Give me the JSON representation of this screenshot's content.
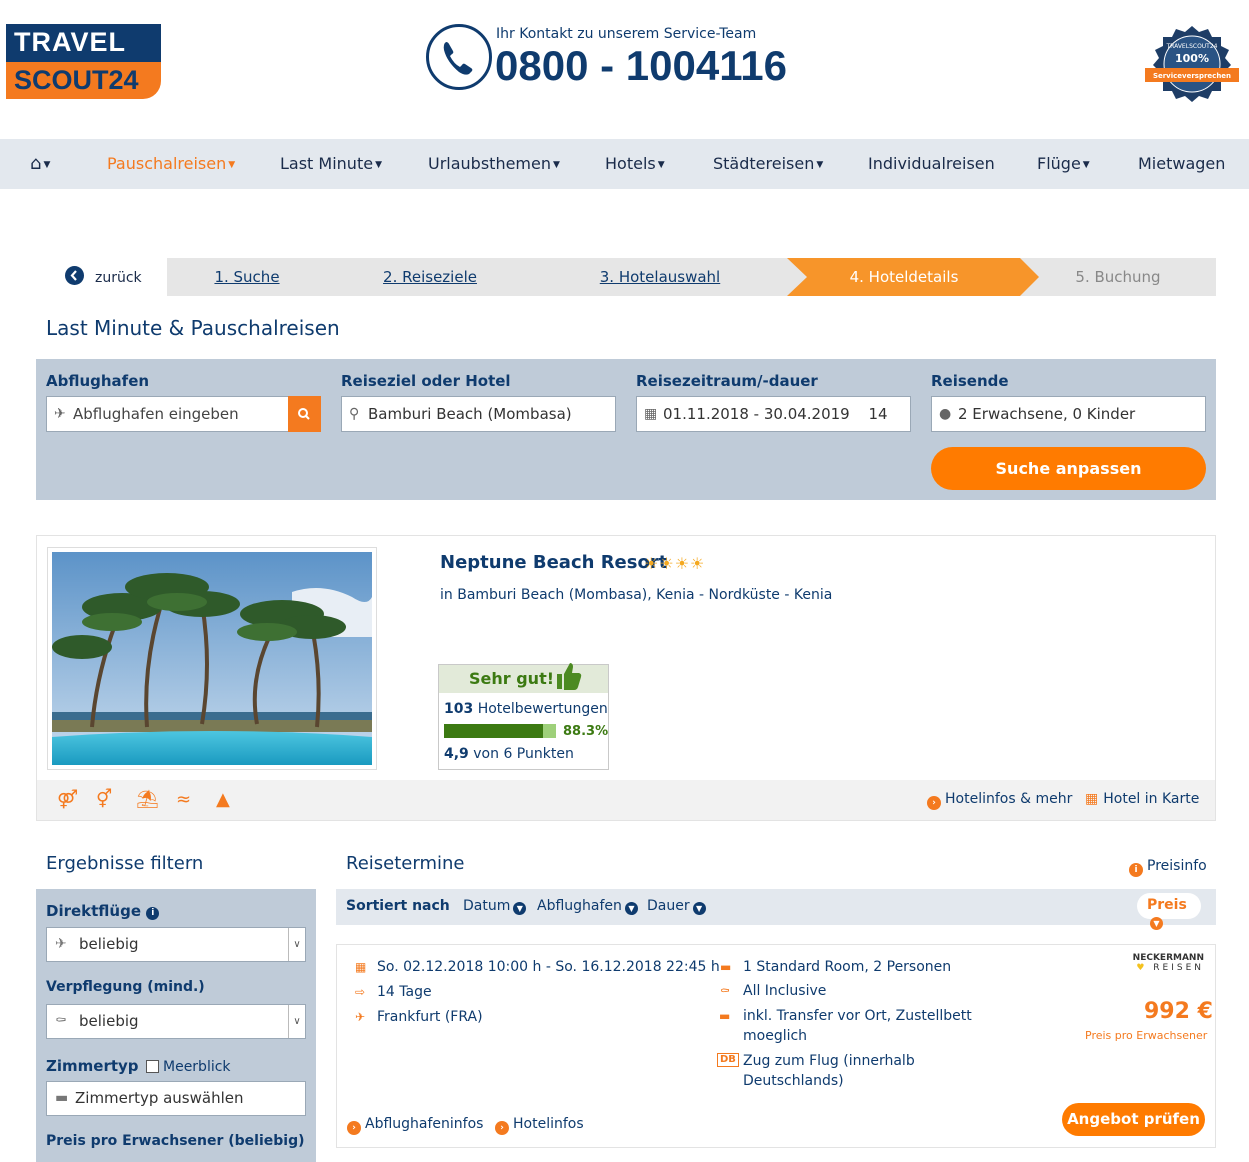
{
  "header": {
    "logo_top": "TRAVEL",
    "logo_bottom": "SCOUT24",
    "contact_label": "Ihr Kontakt zu unserem Service-Team",
    "phone": "0800 - 1004116",
    "seal_percent": "100%",
    "seal_text": "Serviceversprechen",
    "seal_arc": "TRAVELSCOUT24"
  },
  "nav": {
    "items": [
      {
        "label": "Pauschalreisen"
      },
      {
        "label": "Last Minute"
      },
      {
        "label": "Urlaubsthemen"
      },
      {
        "label": "Hotels"
      },
      {
        "label": "Städtereisen"
      },
      {
        "label": "Individualreisen"
      },
      {
        "label": "Flüge"
      },
      {
        "label": "Mietwagen"
      }
    ]
  },
  "steps": {
    "back": "zurück",
    "items": [
      "1. Suche",
      "2. Reiseziele",
      "3. Hotelauswahl",
      "4. Hoteldetails",
      "5. Buchung"
    ]
  },
  "page_title": "Last Minute & Pauschalreisen",
  "search": {
    "departure_label": "Abflughafen",
    "departure_placeholder": "Abflughafen eingeben",
    "destination_label": "Reiseziel oder Hotel",
    "destination_value": "Bamburi Beach (Mombasa)",
    "period_label": "Reisezeitraum/-dauer",
    "period_value": "01.11.2018 - 30.04.2019",
    "duration_value": "14",
    "travellers_label": "Reisende",
    "travellers_value": "2 Erwachsene, 0 Kinder",
    "adjust_button": "Suche anpassen"
  },
  "hotel": {
    "name": "Neptune Beach Resort",
    "stars": "☀☀☀☀",
    "location": "in Bamburi Beach (Mombasa), Kenia - Nordküste - Kenia",
    "rating_word": "Sehr gut!",
    "review_count": "103",
    "review_label": "Hotelbewertungen",
    "percent": "88.3%",
    "percent_value": 88.3,
    "points": "4,9",
    "points_label": "von 6 Punkten",
    "link_info": "Hotelinfos & mehr",
    "link_map": "Hotel in Karte"
  },
  "filter": {
    "title": "Ergebnisse filtern",
    "direct_label": "Direktflüge",
    "direct_value": "beliebig",
    "board_label": "Verpflegung (mind.)",
    "board_value": "beliebig",
    "room_label": "Zimmertyp",
    "seaview_label": "Meerblick",
    "room_placeholder": "Zimmertyp auswählen",
    "price_label": "Preis pro Erwachsener (beliebig)"
  },
  "results": {
    "title": "Reisetermine",
    "price_info": "Preisinfo",
    "sort_label": "Sortiert nach",
    "sort_options": [
      "Datum",
      "Abflughafen",
      "Dauer"
    ],
    "sort_active": "Preis",
    "offer": {
      "dates": "So. 02.12.2018 10:00 h - So. 16.12.2018 22:45 h",
      "duration": "14 Tage",
      "airport": "Frankfurt (FRA)",
      "room": "1 Standard Room, 2 Personen",
      "board": "All Inclusive",
      "transfer_line1": "inkl. Transfer vor Ort, Zustellbett",
      "transfer_line2": "moeglich",
      "train_badge": "DB",
      "train_line1": "Zug zum Flug (innerhalb",
      "train_line2": "Deutschlands)",
      "operator_top": "NECKERMANN",
      "operator_bottom": "REISEN",
      "price": "992 €",
      "price_note": "Preis pro Erwachsener",
      "link_airport": "Abflughafeninfos",
      "link_hotel": "Hotelinfos",
      "check_button": "Angebot prüfen"
    }
  }
}
